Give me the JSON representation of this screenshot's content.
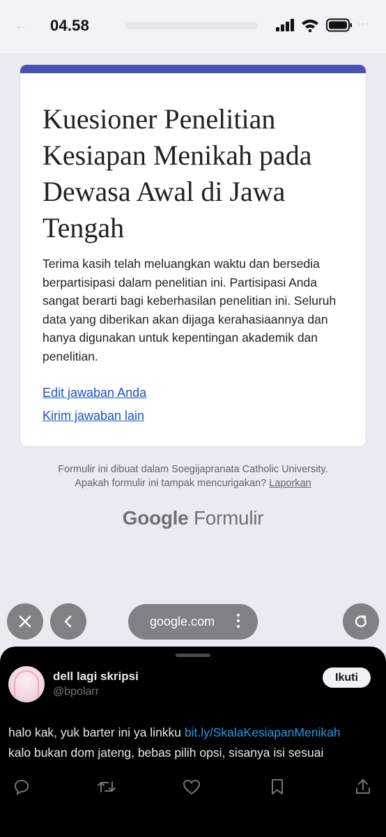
{
  "status_bar": {
    "time": "04.58"
  },
  "form": {
    "title": "Kuesioner Penelitian Kesiapan Menikah pada Dewasa Awal di Jawa Tengah",
    "description": "Terima kasih telah meluangkan waktu dan bersedia berpartisipasi dalam penelitian ini. Partisipasi Anda sangat berarti bagi keberhasilan penelitian ini. Seluruh data yang diberikan akan dijaga kerahasiaannya dan hanya digunakan untuk kepentingan akademik dan penelitian.",
    "edit_link": "Edit jawaban Anda",
    "another_link": "Kirim jawaban lain",
    "accent_color": "#4b51b4"
  },
  "footer": {
    "created_in": "Formulir ini dibuat dalam Soegijapranata Catholic University.",
    "suspicious_prompt": "Apakah formulir ini tampak mencurigakan?",
    "report_link": "Laporkan",
    "brand_google": "Google",
    "brand_product": "Formulir"
  },
  "browser": {
    "url": "google.com",
    "close_icon": "close-icon",
    "back_icon": "chevron-left-icon",
    "reload_icon": "reload-icon",
    "menu_icon": "more-vertical-icon"
  },
  "tweet": {
    "display_name": "dell lagi skripsi",
    "handle": "@bpolarr",
    "follow_label": "Ikuti",
    "line1_text": "halo kak, yuk barter ini ya linkku ",
    "line1_link": "bit.ly/SkalaKesiapanMenikah",
    "line2_text": "kalo bukan dom jateng, bebas pilih opsi, sisanya isi sesuai",
    "actions": [
      "reply-icon",
      "retweet-icon",
      "like-icon",
      "bookmark-icon",
      "share-icon"
    ],
    "link_color": "#1d9bf0"
  }
}
